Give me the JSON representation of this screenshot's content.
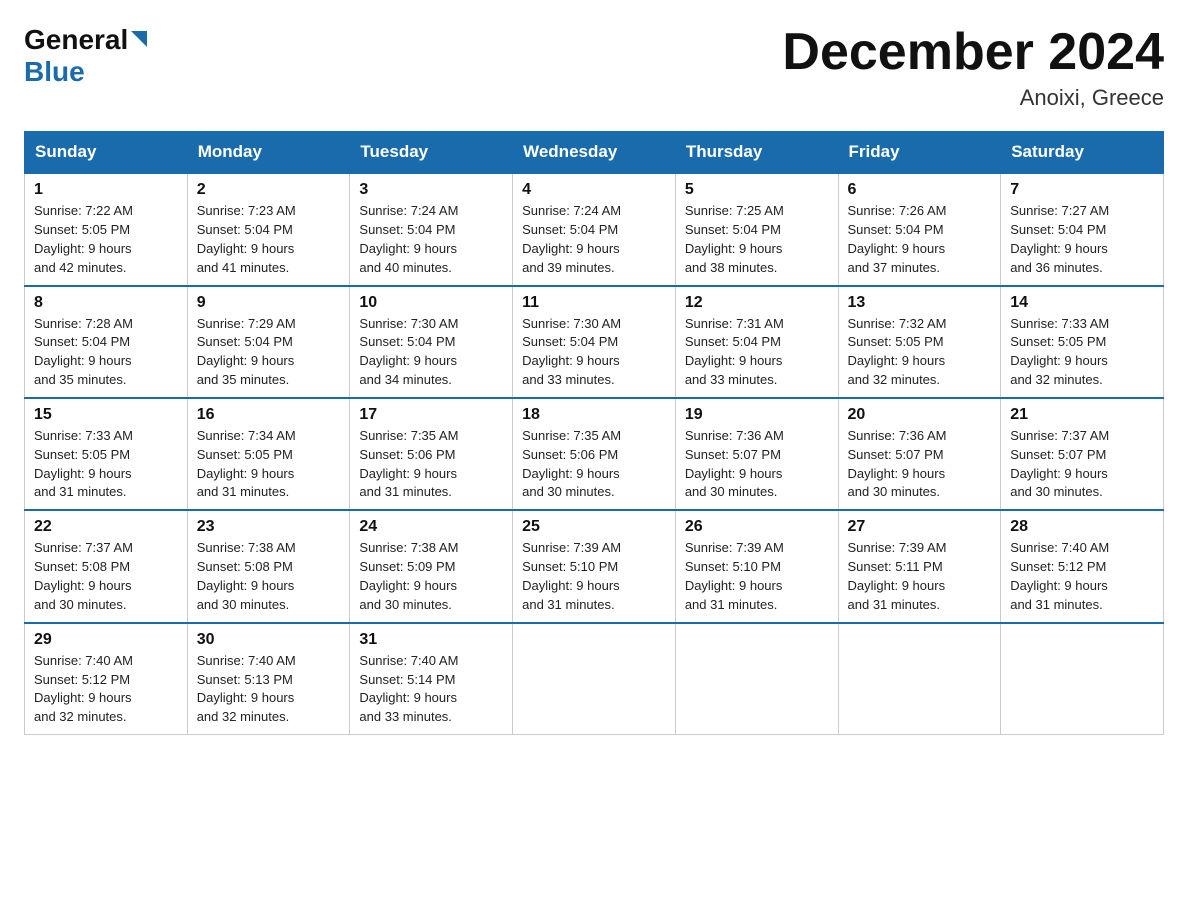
{
  "header": {
    "logo_general": "General",
    "logo_blue": "Blue",
    "month_title": "December 2024",
    "location": "Anoixi, Greece"
  },
  "days_of_week": [
    "Sunday",
    "Monday",
    "Tuesday",
    "Wednesday",
    "Thursday",
    "Friday",
    "Saturday"
  ],
  "weeks": [
    [
      {
        "day": "1",
        "sunrise": "7:22 AM",
        "sunset": "5:05 PM",
        "daylight": "9 hours and 42 minutes."
      },
      {
        "day": "2",
        "sunrise": "7:23 AM",
        "sunset": "5:04 PM",
        "daylight": "9 hours and 41 minutes."
      },
      {
        "day": "3",
        "sunrise": "7:24 AM",
        "sunset": "5:04 PM",
        "daylight": "9 hours and 40 minutes."
      },
      {
        "day": "4",
        "sunrise": "7:24 AM",
        "sunset": "5:04 PM",
        "daylight": "9 hours and 39 minutes."
      },
      {
        "day": "5",
        "sunrise": "7:25 AM",
        "sunset": "5:04 PM",
        "daylight": "9 hours and 38 minutes."
      },
      {
        "day": "6",
        "sunrise": "7:26 AM",
        "sunset": "5:04 PM",
        "daylight": "9 hours and 37 minutes."
      },
      {
        "day": "7",
        "sunrise": "7:27 AM",
        "sunset": "5:04 PM",
        "daylight": "9 hours and 36 minutes."
      }
    ],
    [
      {
        "day": "8",
        "sunrise": "7:28 AM",
        "sunset": "5:04 PM",
        "daylight": "9 hours and 35 minutes."
      },
      {
        "day": "9",
        "sunrise": "7:29 AM",
        "sunset": "5:04 PM",
        "daylight": "9 hours and 35 minutes."
      },
      {
        "day": "10",
        "sunrise": "7:30 AM",
        "sunset": "5:04 PM",
        "daylight": "9 hours and 34 minutes."
      },
      {
        "day": "11",
        "sunrise": "7:30 AM",
        "sunset": "5:04 PM",
        "daylight": "9 hours and 33 minutes."
      },
      {
        "day": "12",
        "sunrise": "7:31 AM",
        "sunset": "5:04 PM",
        "daylight": "9 hours and 33 minutes."
      },
      {
        "day": "13",
        "sunrise": "7:32 AM",
        "sunset": "5:05 PM",
        "daylight": "9 hours and 32 minutes."
      },
      {
        "day": "14",
        "sunrise": "7:33 AM",
        "sunset": "5:05 PM",
        "daylight": "9 hours and 32 minutes."
      }
    ],
    [
      {
        "day": "15",
        "sunrise": "7:33 AM",
        "sunset": "5:05 PM",
        "daylight": "9 hours and 31 minutes."
      },
      {
        "day": "16",
        "sunrise": "7:34 AM",
        "sunset": "5:05 PM",
        "daylight": "9 hours and 31 minutes."
      },
      {
        "day": "17",
        "sunrise": "7:35 AM",
        "sunset": "5:06 PM",
        "daylight": "9 hours and 31 minutes."
      },
      {
        "day": "18",
        "sunrise": "7:35 AM",
        "sunset": "5:06 PM",
        "daylight": "9 hours and 30 minutes."
      },
      {
        "day": "19",
        "sunrise": "7:36 AM",
        "sunset": "5:07 PM",
        "daylight": "9 hours and 30 minutes."
      },
      {
        "day": "20",
        "sunrise": "7:36 AM",
        "sunset": "5:07 PM",
        "daylight": "9 hours and 30 minutes."
      },
      {
        "day": "21",
        "sunrise": "7:37 AM",
        "sunset": "5:07 PM",
        "daylight": "9 hours and 30 minutes."
      }
    ],
    [
      {
        "day": "22",
        "sunrise": "7:37 AM",
        "sunset": "5:08 PM",
        "daylight": "9 hours and 30 minutes."
      },
      {
        "day": "23",
        "sunrise": "7:38 AM",
        "sunset": "5:08 PM",
        "daylight": "9 hours and 30 minutes."
      },
      {
        "day": "24",
        "sunrise": "7:38 AM",
        "sunset": "5:09 PM",
        "daylight": "9 hours and 30 minutes."
      },
      {
        "day": "25",
        "sunrise": "7:39 AM",
        "sunset": "5:10 PM",
        "daylight": "9 hours and 31 minutes."
      },
      {
        "day": "26",
        "sunrise": "7:39 AM",
        "sunset": "5:10 PM",
        "daylight": "9 hours and 31 minutes."
      },
      {
        "day": "27",
        "sunrise": "7:39 AM",
        "sunset": "5:11 PM",
        "daylight": "9 hours and 31 minutes."
      },
      {
        "day": "28",
        "sunrise": "7:40 AM",
        "sunset": "5:12 PM",
        "daylight": "9 hours and 31 minutes."
      }
    ],
    [
      {
        "day": "29",
        "sunrise": "7:40 AM",
        "sunset": "5:12 PM",
        "daylight": "9 hours and 32 minutes."
      },
      {
        "day": "30",
        "sunrise": "7:40 AM",
        "sunset": "5:13 PM",
        "daylight": "9 hours and 32 minutes."
      },
      {
        "day": "31",
        "sunrise": "7:40 AM",
        "sunset": "5:14 PM",
        "daylight": "9 hours and 33 minutes."
      },
      null,
      null,
      null,
      null
    ]
  ]
}
